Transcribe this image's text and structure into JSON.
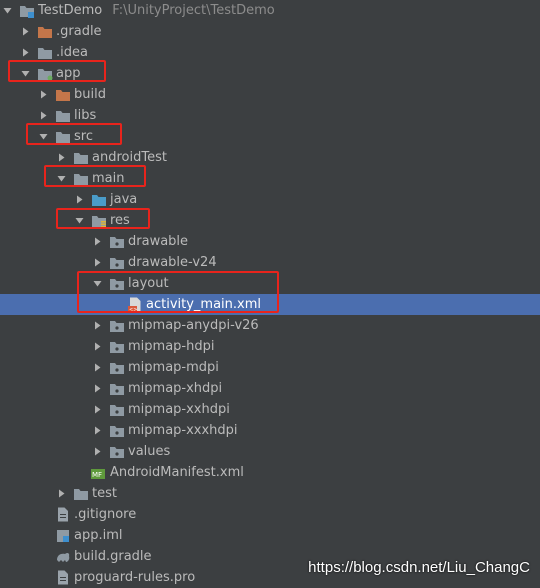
{
  "tree": {
    "project": {
      "name": "TestDemo",
      "path": "F:\\UnityProject\\TestDemo"
    },
    "items": [
      {
        "label": ".gradle",
        "icon": "folder-orange-icon",
        "state": "collapsed"
      },
      {
        "label": ".idea",
        "icon": "folder-icon",
        "state": "collapsed"
      },
      {
        "label": "app",
        "icon": "module-folder-icon",
        "state": "expanded"
      },
      {
        "label": "build",
        "icon": "folder-orange-icon",
        "state": "collapsed"
      },
      {
        "label": "libs",
        "icon": "folder-icon",
        "state": "collapsed"
      },
      {
        "label": "src",
        "icon": "folder-icon",
        "state": "expanded"
      },
      {
        "label": "androidTest",
        "icon": "folder-icon",
        "state": "collapsed"
      },
      {
        "label": "main",
        "icon": "folder-icon",
        "state": "expanded"
      },
      {
        "label": "java",
        "icon": "source-folder-icon",
        "state": "collapsed"
      },
      {
        "label": "res",
        "icon": "resource-folder-icon",
        "state": "expanded"
      },
      {
        "label": "drawable",
        "icon": "package-folder-icon",
        "state": "collapsed"
      },
      {
        "label": "drawable-v24",
        "icon": "package-folder-icon",
        "state": "collapsed"
      },
      {
        "label": "layout",
        "icon": "package-folder-icon",
        "state": "expanded"
      },
      {
        "label": "activity_main.xml",
        "icon": "xml-file-icon",
        "state": "leaf",
        "selected": true
      },
      {
        "label": "mipmap-anydpi-v26",
        "icon": "package-folder-icon",
        "state": "collapsed"
      },
      {
        "label": "mipmap-hdpi",
        "icon": "package-folder-icon",
        "state": "collapsed"
      },
      {
        "label": "mipmap-mdpi",
        "icon": "package-folder-icon",
        "state": "collapsed"
      },
      {
        "label": "mipmap-xhdpi",
        "icon": "package-folder-icon",
        "state": "collapsed"
      },
      {
        "label": "mipmap-xxhdpi",
        "icon": "package-folder-icon",
        "state": "collapsed"
      },
      {
        "label": "mipmap-xxxhdpi",
        "icon": "package-folder-icon",
        "state": "collapsed"
      },
      {
        "label": "values",
        "icon": "package-folder-icon",
        "state": "collapsed"
      },
      {
        "label": "AndroidManifest.xml",
        "icon": "manifest-file-icon",
        "state": "leaf"
      },
      {
        "label": "test",
        "icon": "folder-icon",
        "state": "collapsed"
      },
      {
        "label": ".gitignore",
        "icon": "text-file-icon",
        "state": "leaf"
      },
      {
        "label": "app.iml",
        "icon": "iml-file-icon",
        "state": "leaf"
      },
      {
        "label": "build.gradle",
        "icon": "gradle-file-icon",
        "state": "leaf"
      },
      {
        "label": "proguard-rules.pro",
        "icon": "text-file-icon",
        "state": "leaf"
      }
    ]
  },
  "watermark": "https://blog.csdn.net/Liu_ChangC",
  "colors": {
    "background": "#3c3f41",
    "selection": "#4b6eaf",
    "highlight_box": "#e8241c",
    "folder": "#8f9aa3",
    "folder_orange": "#c4764a"
  }
}
